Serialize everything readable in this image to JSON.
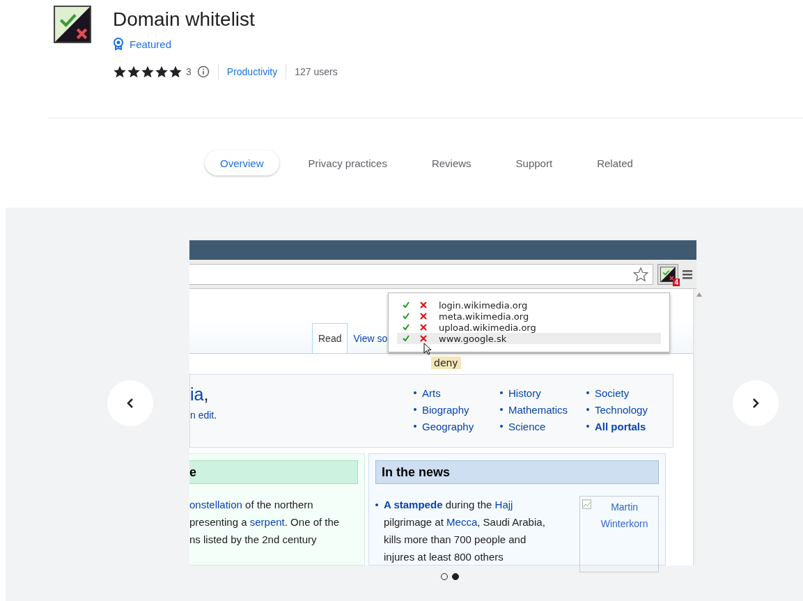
{
  "extension": {
    "title": "Domain whitelist",
    "badge": "Featured",
    "stars": 5,
    "rating_count": "3",
    "category": "Productivity",
    "users": "127 users"
  },
  "tabs": [
    {
      "label": "Overview",
      "selected": true
    },
    {
      "label": "Privacy practices",
      "selected": false
    },
    {
      "label": "Reviews",
      "selected": false
    },
    {
      "label": "Support",
      "selected": false
    },
    {
      "label": "Related",
      "selected": false
    }
  ],
  "gallery": {
    "slides": [
      {
        "selected": false
      },
      {
        "selected": true
      }
    ],
    "screenshot": {
      "extension_badge": "4",
      "popup_rows": [
        {
          "domain": "login.wikimedia.org",
          "highlighted": false
        },
        {
          "domain": "meta.wikimedia.org",
          "highlighted": false
        },
        {
          "domain": "upload.wikimedia.org",
          "highlighted": false
        },
        {
          "domain": "www.google.sk",
          "highlighted": true
        }
      ],
      "tooltip": "deny",
      "page_tabs": [
        {
          "label": "Read",
          "selected": true
        },
        {
          "label": "View so",
          "selected": false
        }
      ],
      "welcome": {
        "title": "ia",
        "title_suffix": ",",
        "subtitle": "n edit",
        "subtitle_suffix": "."
      },
      "portals": [
        [
          {
            "label": "Arts",
            "bold": false
          },
          {
            "label": "Biography",
            "bold": false
          },
          {
            "label": "Geography",
            "bold": false
          }
        ],
        [
          {
            "label": "History",
            "bold": false
          },
          {
            "label": "Mathematics",
            "bold": false
          },
          {
            "label": "Science",
            "bold": false
          }
        ],
        [
          {
            "label": "Society",
            "bold": false
          },
          {
            "label": "Technology",
            "bold": false
          },
          {
            "label": "All portals",
            "bold": true
          }
        ]
      ],
      "featured": {
        "heading": "e",
        "lines": [
          [
            {
              "kind": "link",
              "text": "onstellation"
            },
            {
              "kind": "text",
              "text": " of the northern"
            }
          ],
          [
            {
              "kind": "text",
              "text": "presenting a "
            },
            {
              "kind": "link",
              "text": "serpent"
            },
            {
              "kind": "text",
              "text": ". One of the"
            }
          ],
          [
            {
              "kind": "text",
              "text": "ns listed by the 2nd century"
            }
          ]
        ]
      },
      "news": {
        "heading": "In the news",
        "item": [
          {
            "kind": "strong_link",
            "text": "A stampede"
          },
          {
            "kind": "text",
            "text": " during the "
          },
          {
            "kind": "link",
            "text": "Hajj"
          },
          {
            "kind": "text",
            "text": " pilgrimage at "
          },
          {
            "kind": "link",
            "text": "Mecca"
          },
          {
            "kind": "text",
            "text": ", Saudi Arabia, kills more than 700 people and injures at least 800 others"
          }
        ],
        "image_alt": "Martin Winterkorn"
      }
    }
  }
}
